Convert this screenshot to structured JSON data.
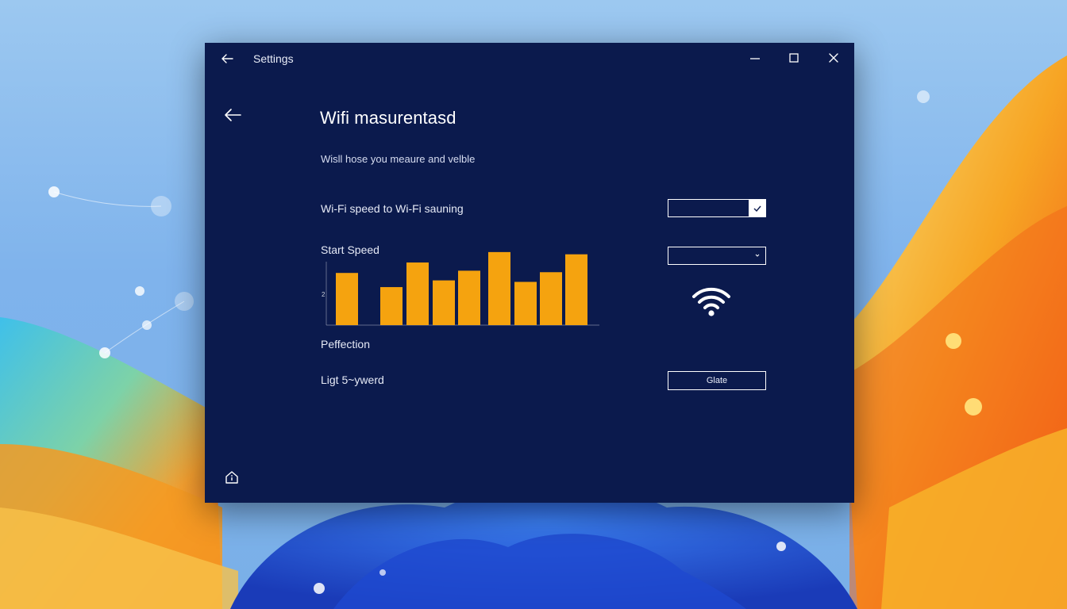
{
  "window": {
    "title": "Settings"
  },
  "page": {
    "title": "Wifi masurentasd",
    "subtitle": "Wisll hose you meaure and velble"
  },
  "rows": [
    {
      "label": "Wi-Fi speed to Wi-Fi sauning"
    },
    {
      "label": "Start Speed"
    },
    {
      "label": "Peffection"
    },
    {
      "label": "Ligt 5~ywerd"
    }
  ],
  "controls": {
    "select1_icon": "check-icon",
    "select2_icon": "chevron-down-icon",
    "action_label": "Glate"
  },
  "chart_data": {
    "type": "bar",
    "ytick_label": "2",
    "values": [
      0.7,
      0.51,
      0.84,
      0.6,
      0.73,
      0.98,
      0.58,
      0.71,
      0.95
    ],
    "bar_color": "#f5a30f",
    "grid": false
  },
  "icons": {
    "back": "arrow-left-icon",
    "minimize": "minimize-icon",
    "maximize": "maximize-icon",
    "close": "close-icon",
    "wifi": "wifi-icon",
    "home": "home-icon"
  },
  "colors": {
    "window_bg": "#0b1a4d",
    "accent": "#f5a30f",
    "text": "#ffffff"
  }
}
